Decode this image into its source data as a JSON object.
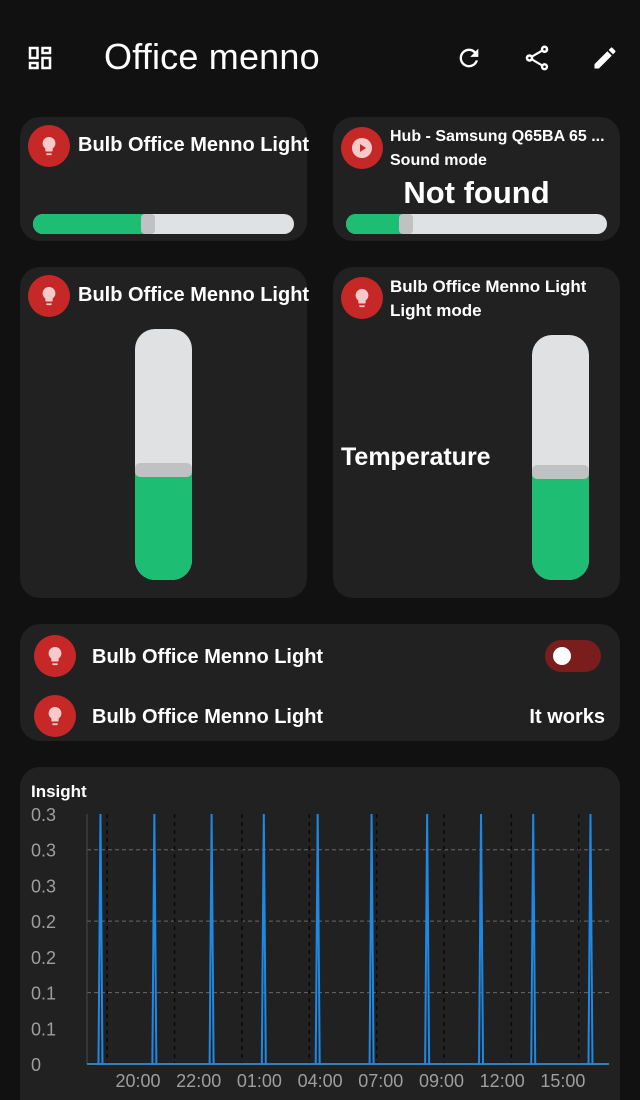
{
  "header": {
    "title": "Office menno",
    "dashboard_icon": "dashboard-icon",
    "refresh_icon": "refresh-icon",
    "share_icon": "share-icon",
    "edit_icon": "pencil-icon"
  },
  "cards": {
    "bulb_slider": {
      "title": "Bulb Office Menno Light",
      "icon": "lightbulb-icon",
      "level": 0.44
    },
    "hub": {
      "title": "Hub - Samsung Q65BA 65 ...",
      "subtitle": "Sound mode",
      "value": "Not found",
      "icon": "play-icon",
      "level": 0.23
    },
    "bulb_vertical": {
      "title": "Bulb Office Menno Light",
      "icon": "lightbulb-icon",
      "level": 0.44
    },
    "bulb_temperature": {
      "title": "Bulb Office Menno Light",
      "subtitle": "Light mode",
      "value": "Temperature",
      "icon": "lightbulb-icon",
      "level": 0.44
    },
    "list": {
      "rows": [
        {
          "label": "Bulb Office Menno Light",
          "icon": "lightbulb-icon",
          "state": "off"
        },
        {
          "label": "Bulb Office Menno Light",
          "icon": "lightbulb-icon",
          "value": "It works"
        }
      ]
    }
  },
  "colors": {
    "background": "#111111",
    "card": "#212121",
    "accent_green": "#1ebd74",
    "icon_red": "#c62828",
    "toggle_off": "#7a1d1d",
    "chart_line": "#1e88e5"
  },
  "chart_data": {
    "type": "line",
    "title": "Insight",
    "x_tick_labels": [
      "20:00",
      "22:00",
      "01:00",
      "04:00",
      "07:00",
      "09:00",
      "12:00",
      "15:00"
    ],
    "y_tick_labels": [
      "0.3",
      "0.3",
      "0.3",
      "0.2",
      "0.2",
      "0.1",
      "0.1",
      "0"
    ],
    "ylim": [
      0,
      0.33
    ],
    "grid": "dashed",
    "series": [
      {
        "spikes_x": [
          0.4,
          2.0,
          3.7,
          5.25,
          6.85,
          8.45,
          10.1,
          11.7,
          13.25,
          14.95
        ],
        "spike_value": 0.33,
        "baseline_value": 0
      }
    ],
    "marker_lines_x": [
      0.6,
      2.6,
      4.6,
      6.6,
      8.6,
      10.6,
      12.6,
      14.6
    ]
  }
}
